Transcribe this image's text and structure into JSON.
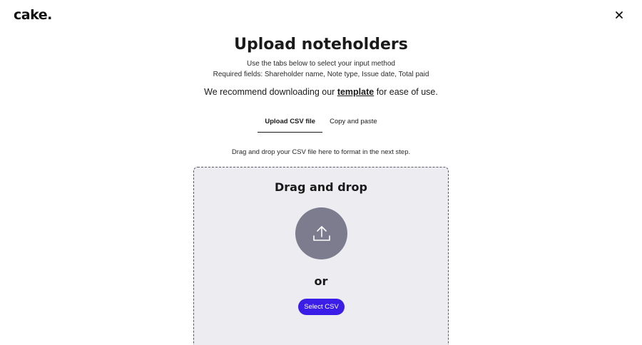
{
  "header": {
    "logo_text": "cake.",
    "close_icon": "close-icon"
  },
  "main": {
    "title": "Upload noteholders",
    "instructions_line1": "Use the tabs below to select your input method",
    "instructions_line2": "Required fields: Shareholder name, Note type, Issue date, Total paid",
    "recommend_prefix": "We recommend downloading our ",
    "recommend_link": "template",
    "recommend_suffix": " for ease of use.",
    "tabs": [
      {
        "label": "Upload CSV file",
        "active": true
      },
      {
        "label": "Copy and paste",
        "active": false
      }
    ],
    "hint": "Drag and drop your CSV file here to format in the next step."
  },
  "dropzone": {
    "title": "Drag and drop",
    "upload_icon": "upload-icon",
    "or_label": "or",
    "select_button_label": "Select CSV"
  },
  "colors": {
    "accent": "#3b1de8",
    "dropzone_bg": "#ececf1",
    "upload_circle": "#7c7c8e"
  }
}
